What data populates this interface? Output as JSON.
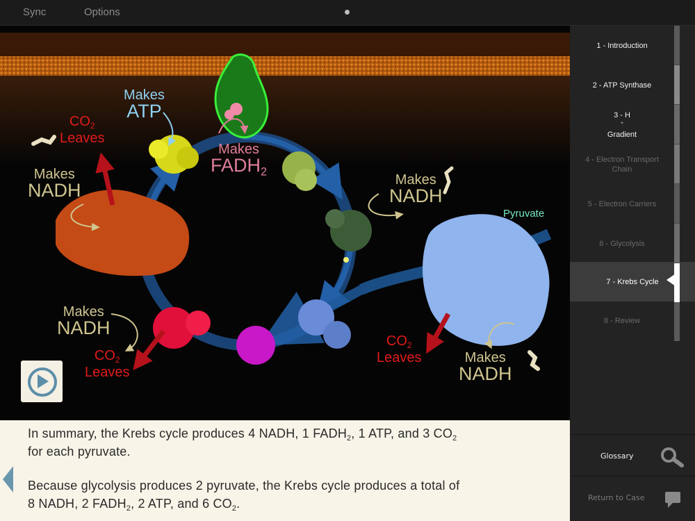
{
  "toolbar": {
    "sync_label": "Sync",
    "options_label": "Options"
  },
  "diagram": {
    "labels": {
      "makes_atp": {
        "line1": "Makes",
        "line2": "ATP"
      },
      "makes_fadh2": {
        "line1": "Makes",
        "line2": "FADH",
        "sub": "2"
      },
      "co2_left_top": {
        "line1": "CO",
        "sub": "2",
        "line2": "Leaves"
      },
      "nadh_left_top": {
        "line1": "Makes",
        "line2": "NADH"
      },
      "nadh_right": {
        "line1": "Makes",
        "line2": "NADH"
      },
      "pyruvate": "Pyruvate",
      "nadh_left_bottom": {
        "line1": "Makes",
        "line2": "NADH"
      },
      "co2_left_bottom": {
        "line1": "CO",
        "sub": "2",
        "line2": "Leaves"
      },
      "co2_right_bottom": {
        "line1": "CO",
        "sub": "2",
        "line2": "Leaves"
      },
      "nadh_right_bottom": {
        "line1": "Makes",
        "line2": "NADH"
      }
    }
  },
  "summary": {
    "p1_a": "In summary, the Krebs cycle produces 4 NADH, 1 FADH",
    "p1_b": ", 1 ATP, and 3 CO",
    "p1_c": "for each pyruvate.",
    "p2_a": "Because glycolysis produces 2 pyruvate, the Krebs cycle produces a total of",
    "p2_b": "8 NADH, 2 FADH",
    "p2_c": ", 2 ATP, and 6 CO",
    "p2_d": ".",
    "sub2": "2"
  },
  "sidebar": {
    "items": [
      {
        "label": "1 - Introduction",
        "state": "visited"
      },
      {
        "label": "2 - ATP Synthase",
        "state": "visited"
      },
      {
        "label_pre": "3 - H",
        "label_sup": "+",
        "label_post": " Gradient",
        "state": "visited"
      },
      {
        "label": "4 - Electron Transport Chain",
        "state": "unvisited"
      },
      {
        "label": "5 - Electron Carriers",
        "state": "unvisited"
      },
      {
        "label": "6 - Glycolysis",
        "state": "unvisited"
      },
      {
        "label": "7 - Krebs Cycle",
        "state": "active"
      },
      {
        "label": "8 - Review",
        "state": "unvisited"
      }
    ],
    "glossary_label": "Glossary",
    "return_label": "Return to Case"
  },
  "colors": {
    "accent_blue": "#6a97ae",
    "label_tan": "#cfc58f",
    "label_red": "#e11b1b",
    "label_atp": "#8fd0f0",
    "label_fadh": "#e07e9a",
    "label_pyruvate": "#77e8c6"
  }
}
